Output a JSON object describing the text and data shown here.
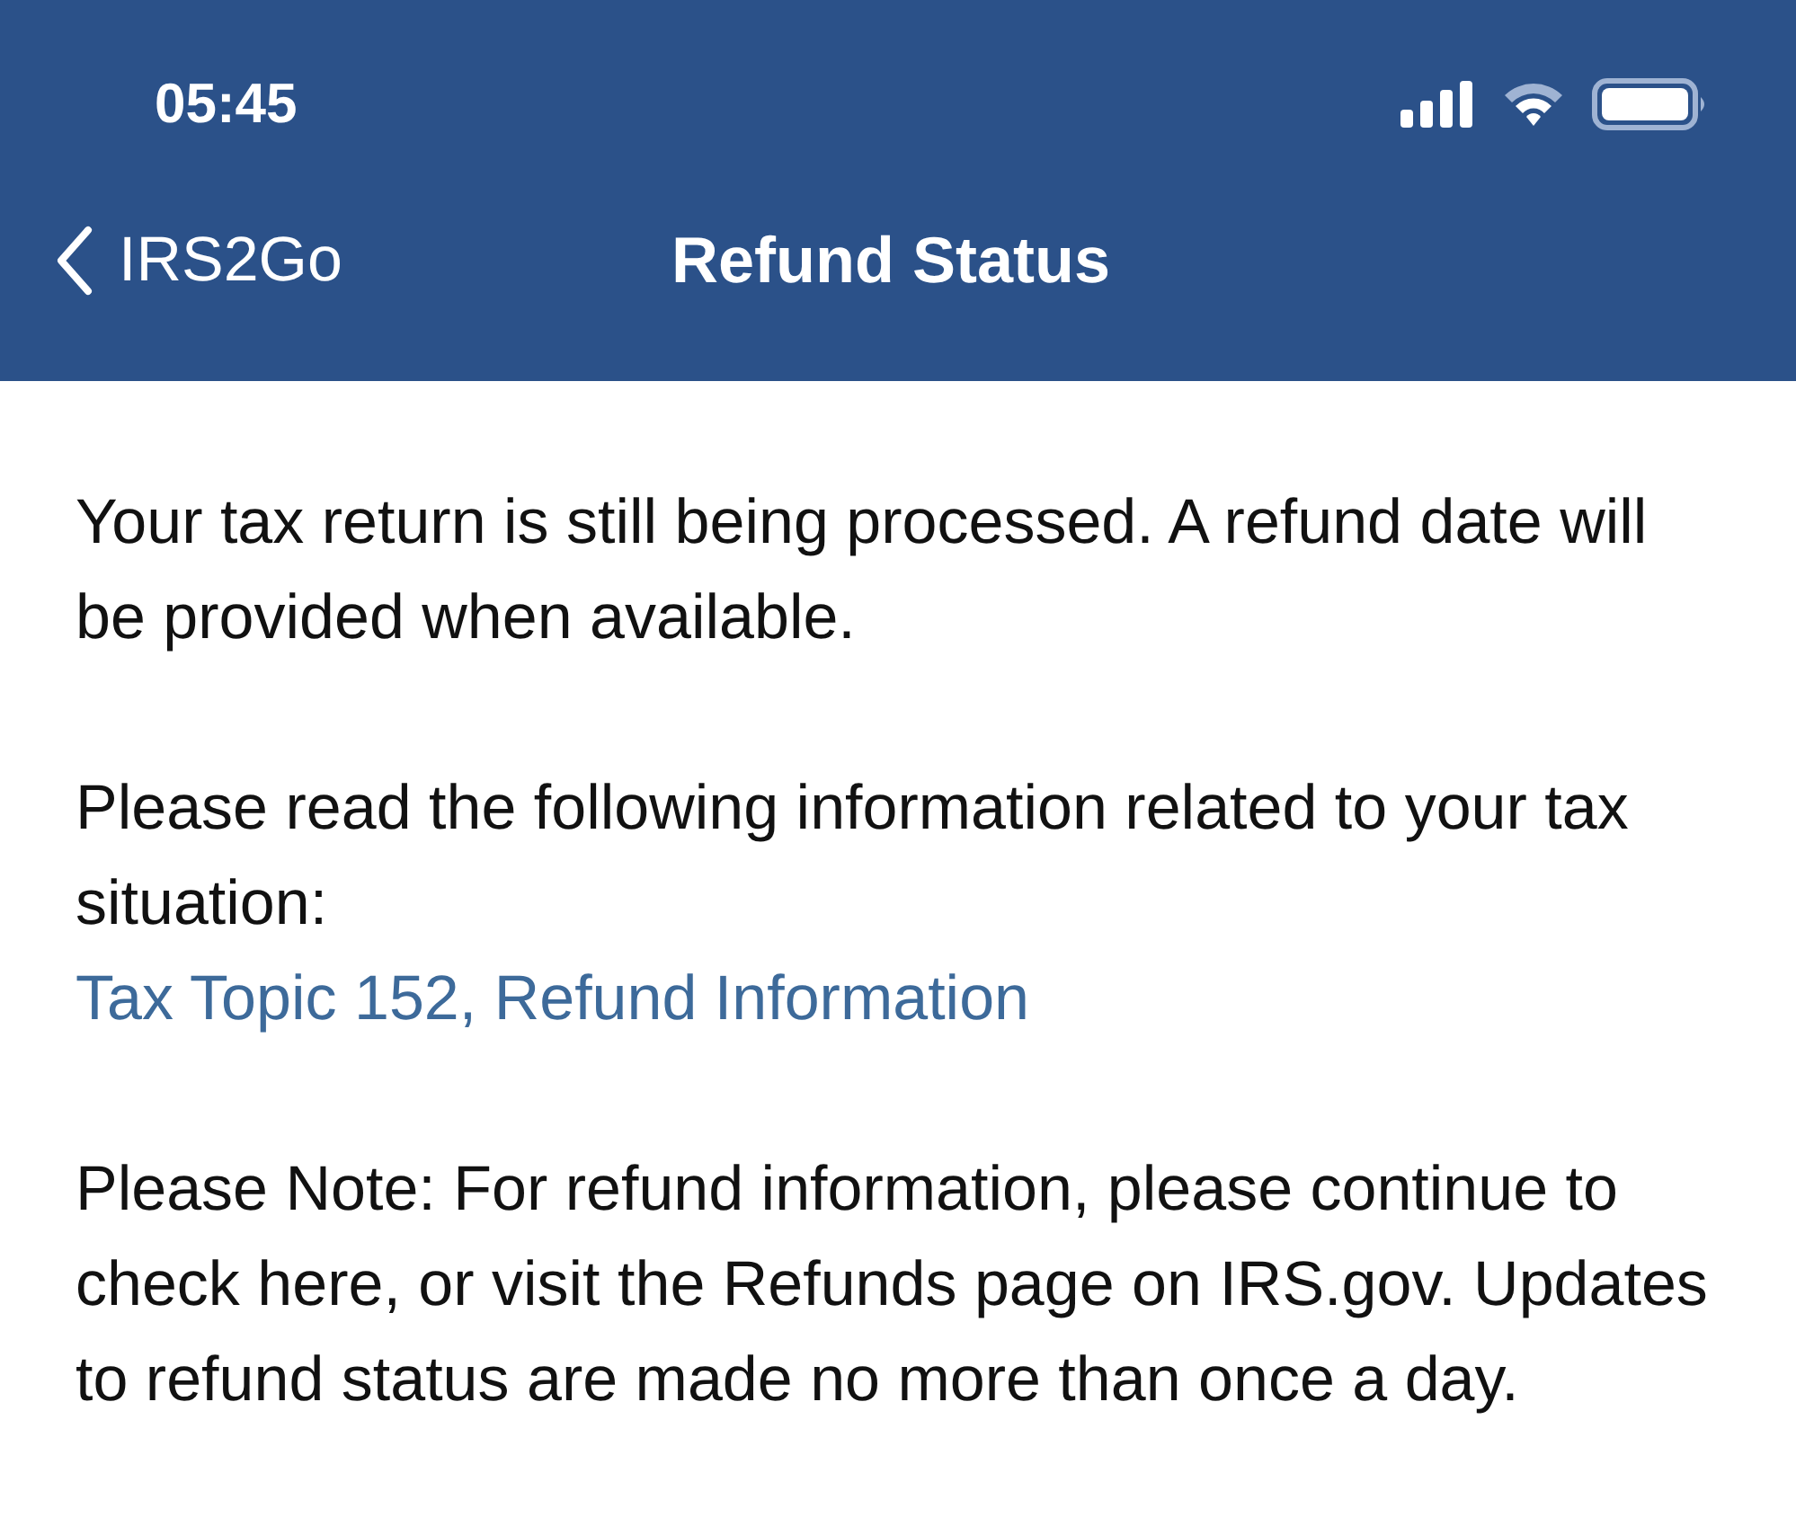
{
  "status_bar": {
    "time": "05:45"
  },
  "nav": {
    "back_label": "IRS2Go",
    "title": "Refund Status"
  },
  "content": {
    "status_message": "Your tax return is still being processed.  A refund date will be provided when available.",
    "info_intro": "Please read the following information related to your tax situation:",
    "info_link": "Tax Topic 152, Refund Information",
    "note": "Please Note: For refund information, please continue to check here, or visit the Refunds page on IRS.gov. Updates to refund status are made no more than once a day."
  }
}
